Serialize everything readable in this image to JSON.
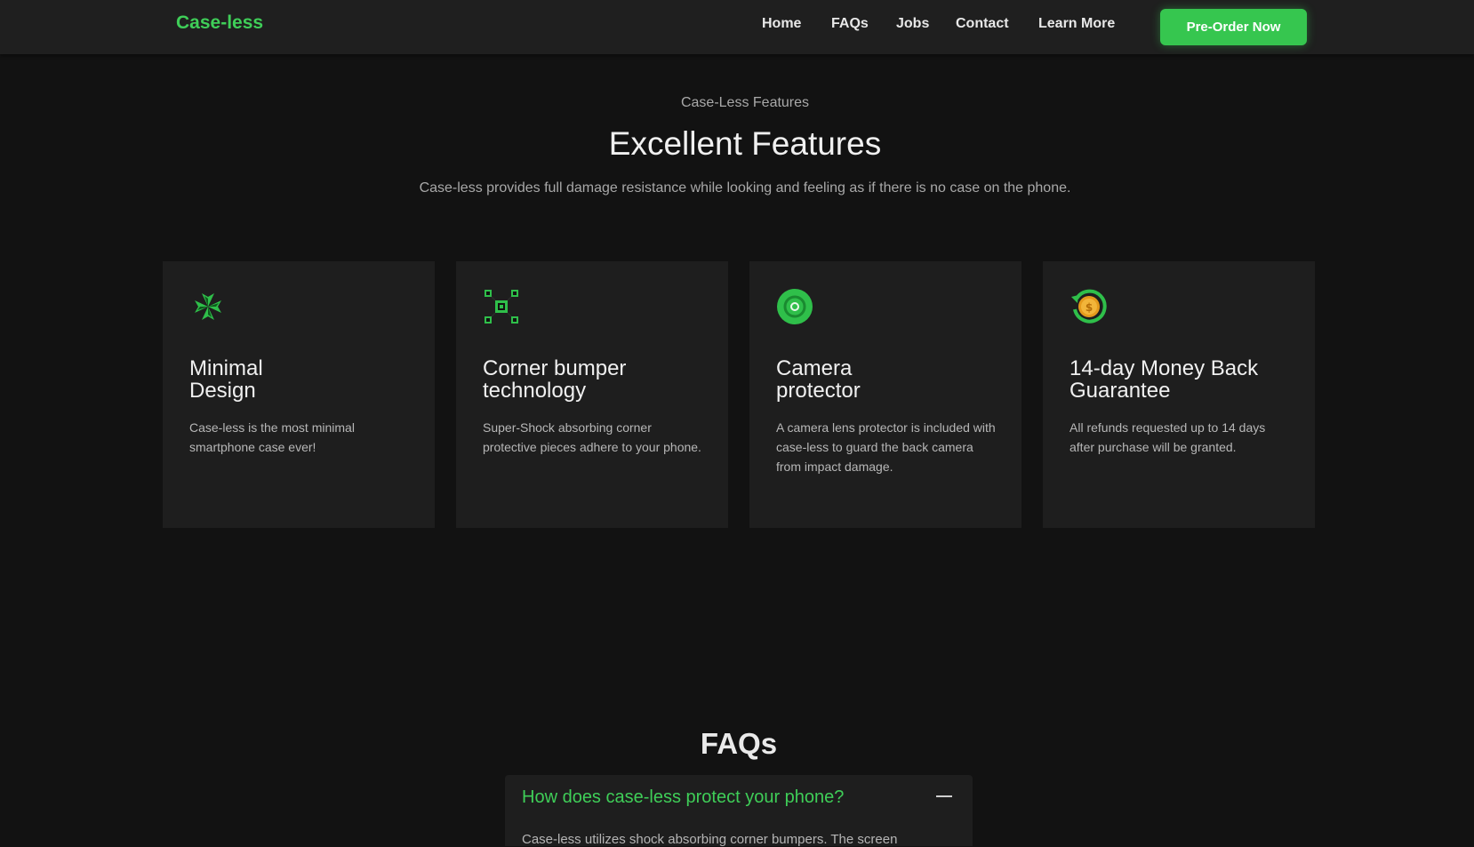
{
  "nav": {
    "brand": "Case-less",
    "links": [
      "Home",
      "FAQs",
      "Jobs",
      "Contact",
      "Learn More"
    ],
    "cta": "Pre-Order Now"
  },
  "features": {
    "eyebrow": "Case-Less Features",
    "title": "Excellent Features",
    "description": "Case-less provides full damage resistance while looking and feeling as if there is no case on the phone.",
    "cards": [
      {
        "icon": "minimal-design-icon",
        "title_line1": "Minimal",
        "title_line2": "Design",
        "text": "Case-less is the most minimal smartphone case ever!"
      },
      {
        "icon": "circuit-icon",
        "title_line1": "Corner bumper",
        "title_line2": "technology",
        "text": "Super-Shock absorbing corner protective pieces adhere to your phone."
      },
      {
        "icon": "camera-lens-icon",
        "title_line1": "Camera",
        "title_line2": "protector",
        "text": "A camera lens protector is included with case-less to guard the back camera from impact damage."
      },
      {
        "icon": "money-back-icon",
        "title_line1": "14-day Money Back",
        "title_line2": "Guarantee",
        "text": "All refunds requested up to 14 days after purchase will be granted."
      }
    ]
  },
  "faq": {
    "title": "FAQs",
    "items": [
      {
        "question": "How does case-less protect your phone?",
        "answer": "Case-less utilizes shock absorbing corner bumpers. The screen"
      }
    ]
  },
  "colors": {
    "accent": "#3fce58",
    "button": "#36c64f",
    "background": "#121212",
    "card": "#1e1e1e",
    "navbar": "#1f1f1f"
  }
}
